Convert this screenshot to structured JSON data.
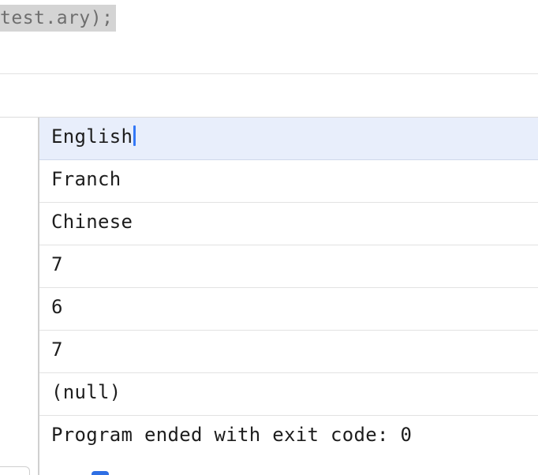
{
  "editor": {
    "code_line": "test.ary);"
  },
  "console": {
    "lines": [
      "English",
      "Franch",
      "Chinese",
      "7",
      "6",
      "7",
      "(null)",
      "Program ended with exit code: 0"
    ]
  },
  "colors": {
    "selection_highlight": "#e8eefb",
    "caret": "#3478f6",
    "code_highlight": "#d4d4d4"
  }
}
